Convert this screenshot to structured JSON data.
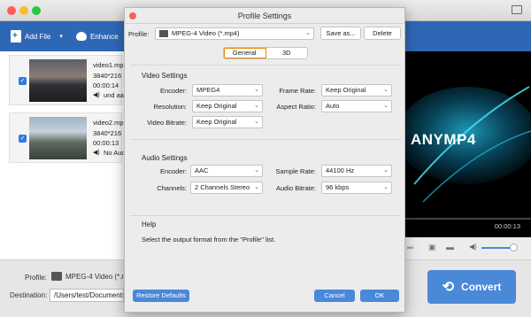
{
  "toolbar": {
    "add_file": "Add File",
    "enhance": "Enhance"
  },
  "files": [
    {
      "name": "video1.mp...",
      "resolution": "3840*216",
      "duration": "00:00:14",
      "audio": "und aac"
    },
    {
      "name": "video2.mp",
      "resolution": "3840*216",
      "duration": "00:00:13",
      "audio": "No Aud"
    }
  ],
  "preview": {
    "brand": "ANYMP4",
    "time": "00:00:13"
  },
  "bottom": {
    "profile_label": "Profile:",
    "profile_value": "MPEG-4 Video (*.mp4)",
    "destination_label": "Destination:",
    "destination_value": "/Users/test/Documents/A",
    "convert": "Convert"
  },
  "dialog": {
    "title": "Profile Settings",
    "profile_label": "Profile:",
    "profile_value": "MPEG-4 Video (*.mp4)",
    "save_as": "Save as...",
    "delete": "Delete",
    "tabs": [
      "General",
      "3D"
    ],
    "video_section": "Video Settings",
    "video": {
      "encoder_label": "Encoder:",
      "encoder": "MPEG4",
      "frame_rate_label": "Frame Rate:",
      "frame_rate": "Keep Original",
      "resolution_label": "Resolution:",
      "resolution": "Keep Original",
      "aspect_label": "Aspect Ratio:",
      "aspect": "Auto",
      "bitrate_label": "Video Bitrate:",
      "bitrate": "Keep Original"
    },
    "audio_section": "Audio Settings",
    "audio": {
      "encoder_label": "Encoder:",
      "encoder": "AAC",
      "sample_label": "Sample Rate:",
      "sample": "44100 Hz",
      "channels_label": "Channels:",
      "channels": "2 Channels Stereo",
      "bitrate_label": "Audio Bitrate:",
      "bitrate": "96 kbps"
    },
    "help_title": "Help",
    "help_text": "Select the output format from the \"Profile\" list.",
    "restore": "Restore Defaults",
    "cancel": "Cancel",
    "ok": "OK"
  }
}
